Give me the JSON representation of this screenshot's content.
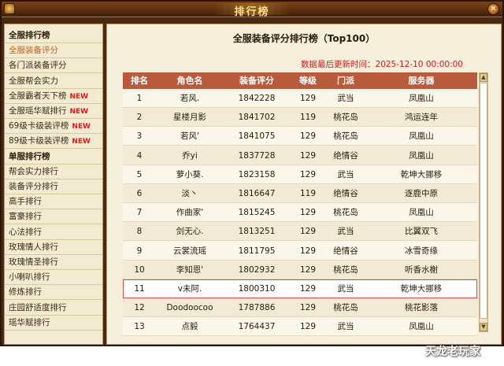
{
  "window": {
    "title": "排行榜",
    "close_label": "✕"
  },
  "sidebar": {
    "items": [
      {
        "label": "全服排行榜",
        "header": true
      },
      {
        "label": "全服装备评分",
        "active": true
      },
      {
        "label": "各门派装备评分"
      },
      {
        "label": "全服帮会实力"
      },
      {
        "label": "全服霸者天下榜",
        "badge": "NEW"
      },
      {
        "label": "全服瑶华赋排行",
        "badge": "NEW"
      },
      {
        "label": "69级卡级装评榜",
        "badge": "NEW"
      },
      {
        "label": "89级卡级装评榜",
        "badge": "NEW"
      },
      {
        "label": "单服排行榜",
        "header": true
      },
      {
        "label": "帮会实力排行"
      },
      {
        "label": "装备评分排行"
      },
      {
        "label": "高手排行"
      },
      {
        "label": "富豪排行"
      },
      {
        "label": "心法排行"
      },
      {
        "label": "玫瑰情人排行"
      },
      {
        "label": "玫瑰情圣排行"
      },
      {
        "label": "小喇叭排行"
      },
      {
        "label": "修炼排行"
      },
      {
        "label": "庄园舒适度排行"
      },
      {
        "label": "瑶华赋排行"
      }
    ]
  },
  "main": {
    "title": "全服装备评分排行榜（Top100）",
    "update_time": "数据最后更新时间：2025-12-10 00:00:00",
    "columns": [
      "排名",
      "角色名",
      "装备评分",
      "等级",
      "门派",
      "服务器"
    ],
    "rows": [
      [
        "1",
        "若风.",
        "1842228",
        "129",
        "武当",
        "凤凰山"
      ],
      [
        "2",
        "星楼月影",
        "1841702",
        "119",
        "桃花岛",
        "鸿运连年"
      ],
      [
        "3",
        "若风'",
        "1841075",
        "129",
        "桃花岛",
        "凤凰山"
      ],
      [
        "4",
        "乔yi",
        "1837728",
        "129",
        "绝情谷",
        "凤凰山"
      ],
      [
        "5",
        "萝小葵.",
        "1823158",
        "129",
        "武当",
        "乾坤大挪移"
      ],
      [
        "6",
        "淡丶",
        "1816647",
        "119",
        "绝情谷",
        "逐鹿中原"
      ],
      [
        "7",
        "作曲家'",
        "1815245",
        "129",
        "桃花岛",
        "凤凰山"
      ],
      [
        "8",
        "剑无心.",
        "1813251",
        "129",
        "武当",
        "比翼双飞"
      ],
      [
        "9",
        "云裳流瑶",
        "1811795",
        "129",
        "绝情谷",
        "冰雪奇缘"
      ],
      [
        "10",
        "李知恩'",
        "1802932",
        "129",
        "桃花岛",
        "听香水榭"
      ],
      [
        "11",
        "v未阿.",
        "1800310",
        "129",
        "武当",
        "乾坤大挪移"
      ],
      [
        "12",
        "Doodoocoo",
        "1787886",
        "129",
        "桃花岛",
        "桃花影落"
      ],
      [
        "13",
        "点毅",
        "1764437",
        "129",
        "武当",
        "凤凰山"
      ]
    ],
    "highlighted_rank": "11"
  },
  "watermark": "天龙老玩家",
  "colors": {
    "header_bg": "#b85a3c",
    "accent_red": "#d01818",
    "frame": "#4a2a12"
  }
}
